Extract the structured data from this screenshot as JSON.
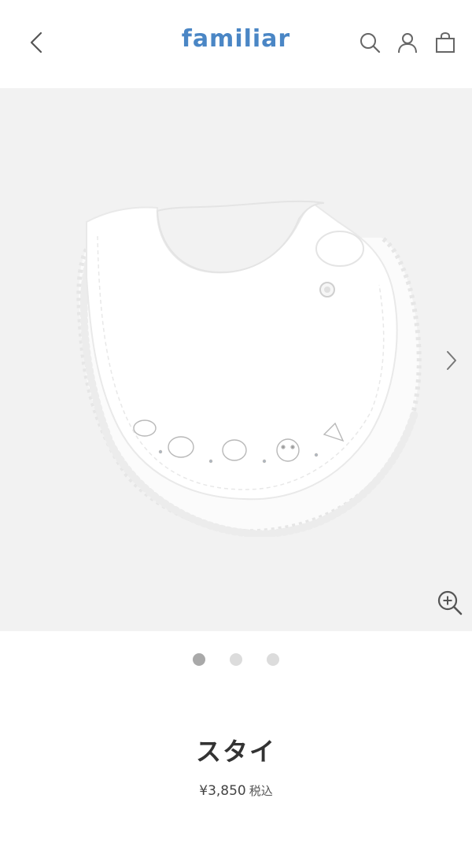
{
  "header": {
    "logo": "familiar",
    "back_icon": "chevron-left-icon",
    "icons": [
      "search-icon",
      "user-icon",
      "bag-icon"
    ],
    "brand_color": "#4a86c5"
  },
  "gallery": {
    "background": "#f2f2f2",
    "image_alt": "bib",
    "next_icon": "chevron-right-icon",
    "zoom_icon": "zoom-in-icon",
    "dots": [
      {
        "active": true
      },
      {
        "active": false
      },
      {
        "active": false
      }
    ]
  },
  "product": {
    "name": "スタイ",
    "price": "¥3,850",
    "tax_label": "税込"
  }
}
